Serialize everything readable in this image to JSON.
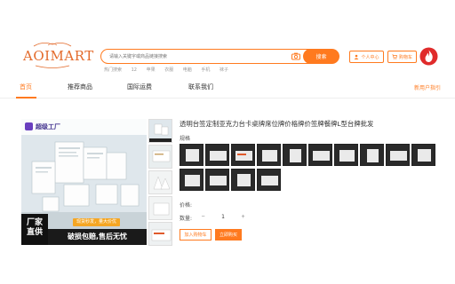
{
  "logo": {
    "text": "AOIMART"
  },
  "search": {
    "placeholder": "请输入关键字或商品链接搜索",
    "button": "搜索"
  },
  "hot": {
    "label": "热门搜索",
    "items": [
      "12",
      "苹果",
      "衣服",
      "电脑",
      "手机",
      "袜子"
    ]
  },
  "header": {
    "user_center": "个人中心",
    "cart": "购物车"
  },
  "nav": {
    "items": [
      "首页",
      "推荐商品",
      "国际运费",
      "联系我们"
    ],
    "help": "新用户指引"
  },
  "gallery": {
    "brand": "超级工厂",
    "banner1": "厂家",
    "banner2": "直供",
    "badge": "现货秒发，量大价优",
    "slogan": "破损包赔,售后无忧"
  },
  "product": {
    "title": "透明台签定制亚克力台卡桌牌席位牌价格牌价签牌餐牌L型台牌批发",
    "spec_label": "规格",
    "price_label": "价格:",
    "qty_label": "数量:",
    "qty_value": "1",
    "add_to_cart": "加入购物车",
    "buy_now": "立即购买"
  },
  "colors": {
    "accent": "#ff7a1f"
  }
}
